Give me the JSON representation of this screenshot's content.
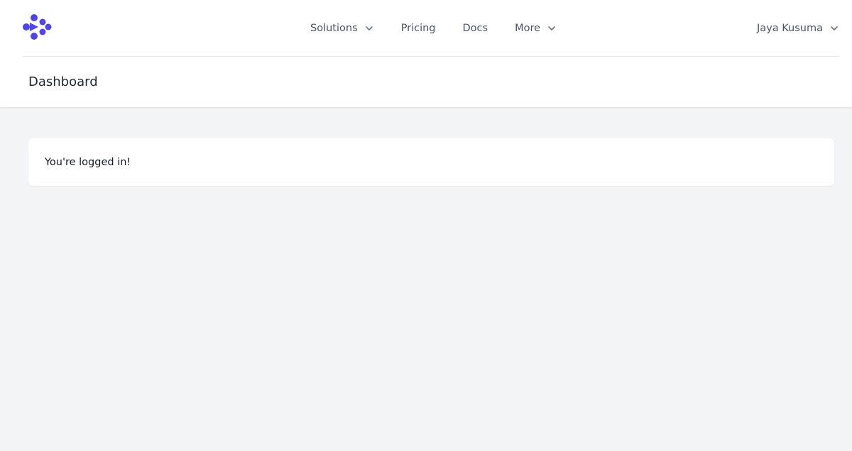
{
  "nav": {
    "items": [
      {
        "label": "Solutions",
        "has_dropdown": true
      },
      {
        "label": "Pricing",
        "has_dropdown": false
      },
      {
        "label": "Docs",
        "has_dropdown": false
      },
      {
        "label": "More",
        "has_dropdown": true
      }
    ],
    "user_name": "Jaya Kusuma"
  },
  "header": {
    "title": "Dashboard"
  },
  "main": {
    "message": "You're logged in!"
  },
  "colors": {
    "brand": "#4f46e5",
    "page_bg": "#f3f4f6",
    "nav_text": "#4b5563"
  },
  "icons": {
    "logo": "brand-logo-icon",
    "dropdown": "chevron-down-icon"
  }
}
